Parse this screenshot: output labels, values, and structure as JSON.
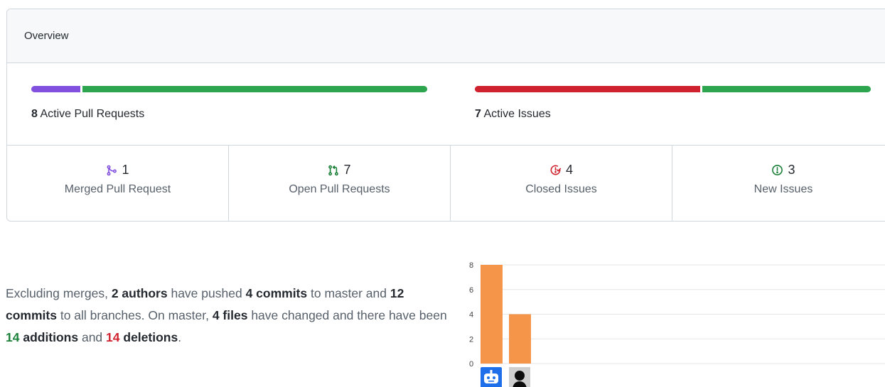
{
  "overview": {
    "title": "Overview"
  },
  "pull_requests": {
    "active_count": "8",
    "active_label": "Active Pull Requests",
    "merged": 1,
    "open": 7
  },
  "issues": {
    "active_count": "7",
    "active_label": "Active Issues",
    "closed": 4,
    "new": 3
  },
  "stats": [
    {
      "icon": "merge-icon",
      "value": "1",
      "label": "Merged Pull Request",
      "color": "#8250df"
    },
    {
      "icon": "pull-request-icon",
      "value": "7",
      "label": "Open Pull Requests",
      "color": "#1a7f37"
    },
    {
      "icon": "issue-closed-icon",
      "value": "4",
      "label": "Closed Issues",
      "color": "#cf222e"
    },
    {
      "icon": "issue-opened-icon",
      "value": "3",
      "label": "New Issues",
      "color": "#1a7f37"
    }
  ],
  "colors": {
    "merged": "#8250df",
    "open": "#2da44e",
    "closed": "#cf222e",
    "new": "#2da44e",
    "bar": "#f4954a"
  },
  "summary": {
    "p1": "Excluding merges, ",
    "authors": "2 authors",
    "p2": " have pushed ",
    "commits_master": "4 commits",
    "p3": " to master and ",
    "commits_all": "12 commits",
    "p4": " to all branches. On master, ",
    "files": "4 files",
    "p5": " have changed and there have been ",
    "additions_num": "14",
    "additions_word": " additions",
    "p6": " and ",
    "deletions_num": "14",
    "deletions_word": " deletions",
    "p7": "."
  },
  "chart_data": {
    "type": "bar",
    "categories": [
      "bot-author",
      "user-author"
    ],
    "values": [
      8,
      4
    ],
    "yticks": [
      "0",
      "2",
      "4",
      "6",
      "8"
    ],
    "ylim": [
      0,
      8
    ],
    "grid": true,
    "bar_color": "#f4954a"
  }
}
